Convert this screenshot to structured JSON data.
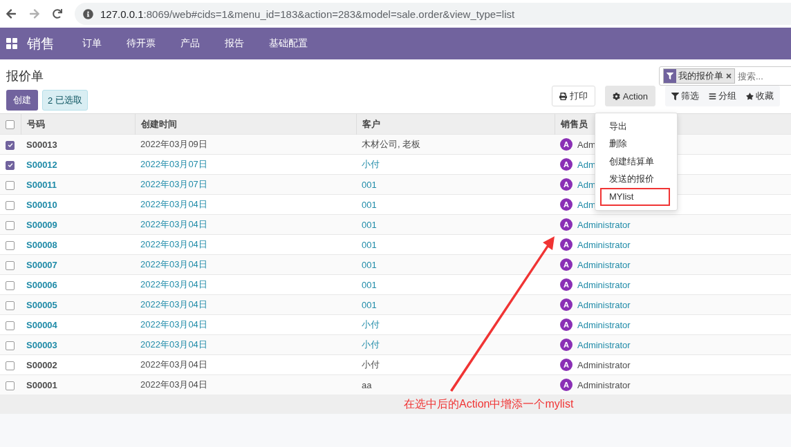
{
  "browser": {
    "url_host": "127.0.0.1",
    "url_rest": ":8069/web#cids=1&menu_id=183&action=283&model=sale.order&view_type=list"
  },
  "navbar": {
    "app": "销售",
    "menus": [
      "订单",
      "待开票",
      "产品",
      "报告",
      "基础配置"
    ]
  },
  "title": "报价单",
  "create_button": "创建",
  "selection": {
    "count": "2",
    "label": "已选取"
  },
  "print_button": "打印",
  "action_button": {
    "label": "Action",
    "expanded": true
  },
  "search": {
    "facet": "我的报价单",
    "placeholder": "搜索..."
  },
  "search_options": [
    {
      "kind": "filter",
      "label": "筛选"
    },
    {
      "kind": "group",
      "label": "分组"
    },
    {
      "kind": "favorite",
      "label": "收藏"
    }
  ],
  "action_menu": [
    {
      "label": "导出",
      "annotated": false
    },
    {
      "label": "删除",
      "annotated": false
    },
    {
      "label": "创建结算单",
      "annotated": false
    },
    {
      "label": "发送的报价",
      "annotated": false
    },
    {
      "label": "MYlist",
      "annotated": true
    }
  ],
  "table": {
    "all_checked": false,
    "columns": [
      "号码",
      "创建时间",
      "客户",
      "销售员"
    ],
    "rows": [
      {
        "checked": true,
        "highlighted": false,
        "number": "S00013",
        "date": "2022年03月09日",
        "customer": "木材公司, 老板",
        "avatar": "A",
        "salesperson": "Adm"
      },
      {
        "checked": true,
        "highlighted": true,
        "number": "S00012",
        "date": "2022年03月07日",
        "customer": "小付",
        "avatar": "A",
        "salesperson": "Adm"
      },
      {
        "checked": false,
        "highlighted": true,
        "number": "S00011",
        "date": "2022年03月07日",
        "customer": "001",
        "avatar": "A",
        "salesperson": "Adm"
      },
      {
        "checked": false,
        "highlighted": true,
        "number": "S00010",
        "date": "2022年03月04日",
        "customer": "001",
        "avatar": "A",
        "salesperson": "Adm"
      },
      {
        "checked": false,
        "highlighted": true,
        "number": "S00009",
        "date": "2022年03月04日",
        "customer": "001",
        "avatar": "A",
        "salesperson": "Administrator"
      },
      {
        "checked": false,
        "highlighted": true,
        "number": "S00008",
        "date": "2022年03月04日",
        "customer": "001",
        "avatar": "A",
        "salesperson": "Administrator"
      },
      {
        "checked": false,
        "highlighted": true,
        "number": "S00007",
        "date": "2022年03月04日",
        "customer": "001",
        "avatar": "A",
        "salesperson": "Administrator"
      },
      {
        "checked": false,
        "highlighted": true,
        "number": "S00006",
        "date": "2022年03月04日",
        "customer": "001",
        "avatar": "A",
        "salesperson": "Administrator"
      },
      {
        "checked": false,
        "highlighted": true,
        "number": "S00005",
        "date": "2022年03月04日",
        "customer": "001",
        "avatar": "A",
        "salesperson": "Administrator"
      },
      {
        "checked": false,
        "highlighted": true,
        "number": "S00004",
        "date": "2022年03月04日",
        "customer": "小付",
        "avatar": "A",
        "salesperson": "Administrator"
      },
      {
        "checked": false,
        "highlighted": true,
        "number": "S00003",
        "date": "2022年03月04日",
        "customer": "小付",
        "avatar": "A",
        "salesperson": "Administrator"
      },
      {
        "checked": false,
        "highlighted": false,
        "number": "S00002",
        "date": "2022年03月04日",
        "customer": "小付",
        "avatar": "A",
        "salesperson": "Administrator"
      },
      {
        "checked": false,
        "highlighted": false,
        "number": "S00001",
        "date": "2022年03月04日",
        "customer": "aa",
        "avatar": "A",
        "salesperson": "Administrator"
      }
    ]
  },
  "annotation": {
    "note": "在选中后的Action中增添一个mylist"
  }
}
